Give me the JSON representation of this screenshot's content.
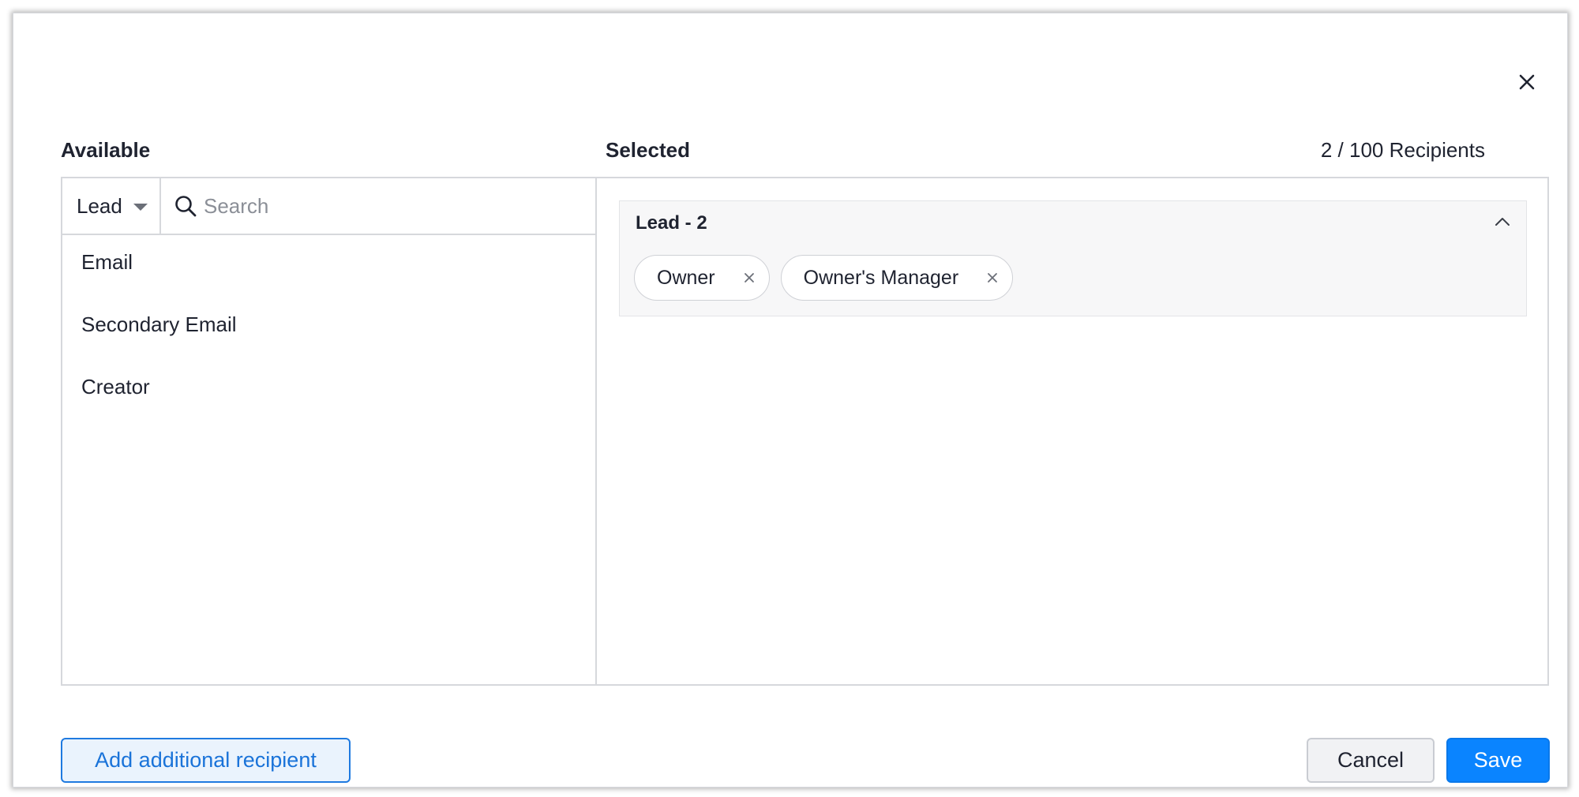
{
  "dialog": {
    "available_label": "Available",
    "selected_label": "Selected",
    "recipient_count": "2 / 100 Recipients"
  },
  "available": {
    "module": "Lead",
    "search_placeholder": "Search",
    "items": [
      {
        "label": "Email"
      },
      {
        "label": "Secondary Email"
      },
      {
        "label": "Creator"
      }
    ]
  },
  "selected": {
    "groups": [
      {
        "title": "Lead - 2",
        "chips": [
          {
            "label": "Owner"
          },
          {
            "label": "Owner's Manager"
          }
        ]
      }
    ]
  },
  "footer": {
    "add_label": "Add additional recipient",
    "cancel_label": "Cancel",
    "save_label": "Save"
  },
  "colors": {
    "primary": "#0a84ff",
    "link": "#1a73d9",
    "border": "#d6d8dc"
  },
  "icons": {
    "close": "close-icon",
    "search": "search-icon",
    "collapse": "chevron-up-icon",
    "remove": "remove-icon",
    "dropdown": "caret-down-icon"
  }
}
